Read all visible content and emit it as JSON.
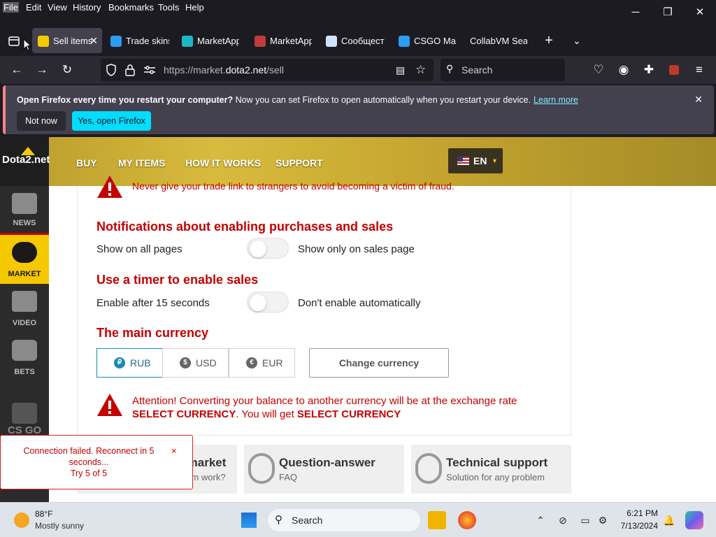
{
  "menu": [
    "File",
    "Edit",
    "View",
    "History",
    "Bookmarks",
    "Tools",
    "Help"
  ],
  "tabs": [
    {
      "title": "Sell items",
      "active": true
    },
    {
      "title": "Trade skins"
    },
    {
      "title": "MarketApp"
    },
    {
      "title": "MarketApp"
    },
    {
      "title": "Сообщест"
    },
    {
      "title": "CSGO Mar"
    },
    {
      "title": "CollabVM Sear"
    }
  ],
  "nav": {
    "url_prefix": "https://market.",
    "url_domain": "dota2.net",
    "url_path": "/sell",
    "search_placeholder": "Search"
  },
  "notification": {
    "title": "Open Firefox every time you restart your computer?",
    "body": "Now you can set Firefox to open automatically when you restart your device.",
    "learn_more": "Learn more",
    "not_now": "Not now",
    "yes_open": "Yes, open Firefox"
  },
  "site": {
    "logo": "Dota2.net",
    "nav": [
      "BUY",
      "MY ITEMS",
      "HOW IT WORKS",
      "SUPPORT"
    ],
    "lang": "EN",
    "sidebar": [
      "NEWS",
      "MARKET",
      "VIDEO",
      "BETS",
      "CS GO"
    ]
  },
  "settings": {
    "partial_warning": "Never give your trade link to strangers to avoid becoming a victim of fraud.",
    "notif_title": "Notifications about enabling purchases and sales",
    "notif_left": "Show on all pages",
    "notif_right": "Show only on sales page",
    "timer_title": "Use a timer to enable sales",
    "timer_left": "Enable after 15 seconds",
    "timer_right": "Don't enable automatically",
    "currency_title": "The main currency",
    "currencies": [
      {
        "code": "RUB",
        "symbol": "₽",
        "selected": true
      },
      {
        "code": "USD",
        "symbol": "$",
        "selected": false
      },
      {
        "code": "EUR",
        "symbol": "€",
        "selected": false
      }
    ],
    "change_currency": "Change currency",
    "attention_1": "Attention! Converting your balance to another currency will be at the exchange rate ",
    "attention_sel1": "SELECT CURRENCY",
    "attention_2": ". You will get ",
    "attention_sel2": "SELECT CURRENCY"
  },
  "cards": [
    {
      "title": "All about the market",
      "sub": "How does the system work?"
    },
    {
      "title": "Question-answer",
      "sub": "FAQ"
    },
    {
      "title": "Technical support",
      "sub": "Solution for any problem"
    }
  ],
  "toast": {
    "line1": "Connection failed. Reconnect in 5 seconds...",
    "line2": "Try 5 of 5",
    "close": "×"
  },
  "taskbar": {
    "temp": "88°F",
    "weather": "Mostly sunny",
    "search": "Search",
    "time": "6:21 PM",
    "date": "7/13/2024"
  },
  "colors": {
    "accent": "#c40000",
    "brand_yellow": "#f5c800",
    "selected_currency": "#1a8ab0"
  }
}
